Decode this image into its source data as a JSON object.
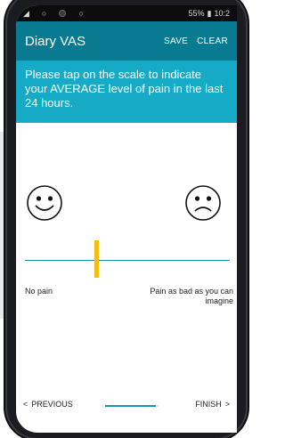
{
  "status_bar": {
    "battery": "55%",
    "time": "10:2"
  },
  "appbar": {
    "title": "Diary VAS",
    "save_label": "SAVE",
    "clear_label": "CLEAR"
  },
  "instruction": "Please tap on the scale to indicate your AVERAGE level of pain in the last 24 hours.",
  "scale": {
    "left_label": "No pain",
    "right_label": "Pain as bad as you can imagine",
    "marker_value": 0.35
  },
  "nav": {
    "prev_label": "PREVIOUS",
    "next_label": "FINISH",
    "progress": 0.95
  },
  "colors": {
    "appbar": "#087a92",
    "instruction_bg": "#16aac7",
    "scale_line": "#1796b3",
    "marker": "#f3bd16"
  },
  "icons": [
    "happy-face-icon",
    "sad-face-icon",
    "chevron-left-icon",
    "chevron-right-icon",
    "battery-icon",
    "signal-icon"
  ]
}
